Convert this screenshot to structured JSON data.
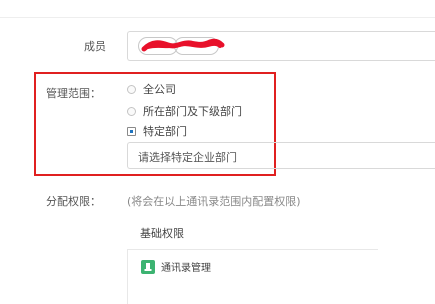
{
  "member": {
    "label": "成员",
    "tags": [
      "",
      ""
    ]
  },
  "scope": {
    "label": "管理范围：",
    "options": [
      "全公司",
      "所在部门及下级部门",
      "特定部门"
    ],
    "selected_index": 2,
    "dept_select_placeholder": "请选择特定企业部门"
  },
  "assign": {
    "label": "分配权限：",
    "note": "(将会在以上通讯录范围内配置权限)",
    "basic_title": "基础权限",
    "permissions": [
      {
        "icon": "contacts-icon",
        "label": "通讯录管理"
      }
    ]
  },
  "colors": {
    "highlight": "#e02020",
    "accent": "#1e73be",
    "perm_icon": "#3cb371"
  }
}
